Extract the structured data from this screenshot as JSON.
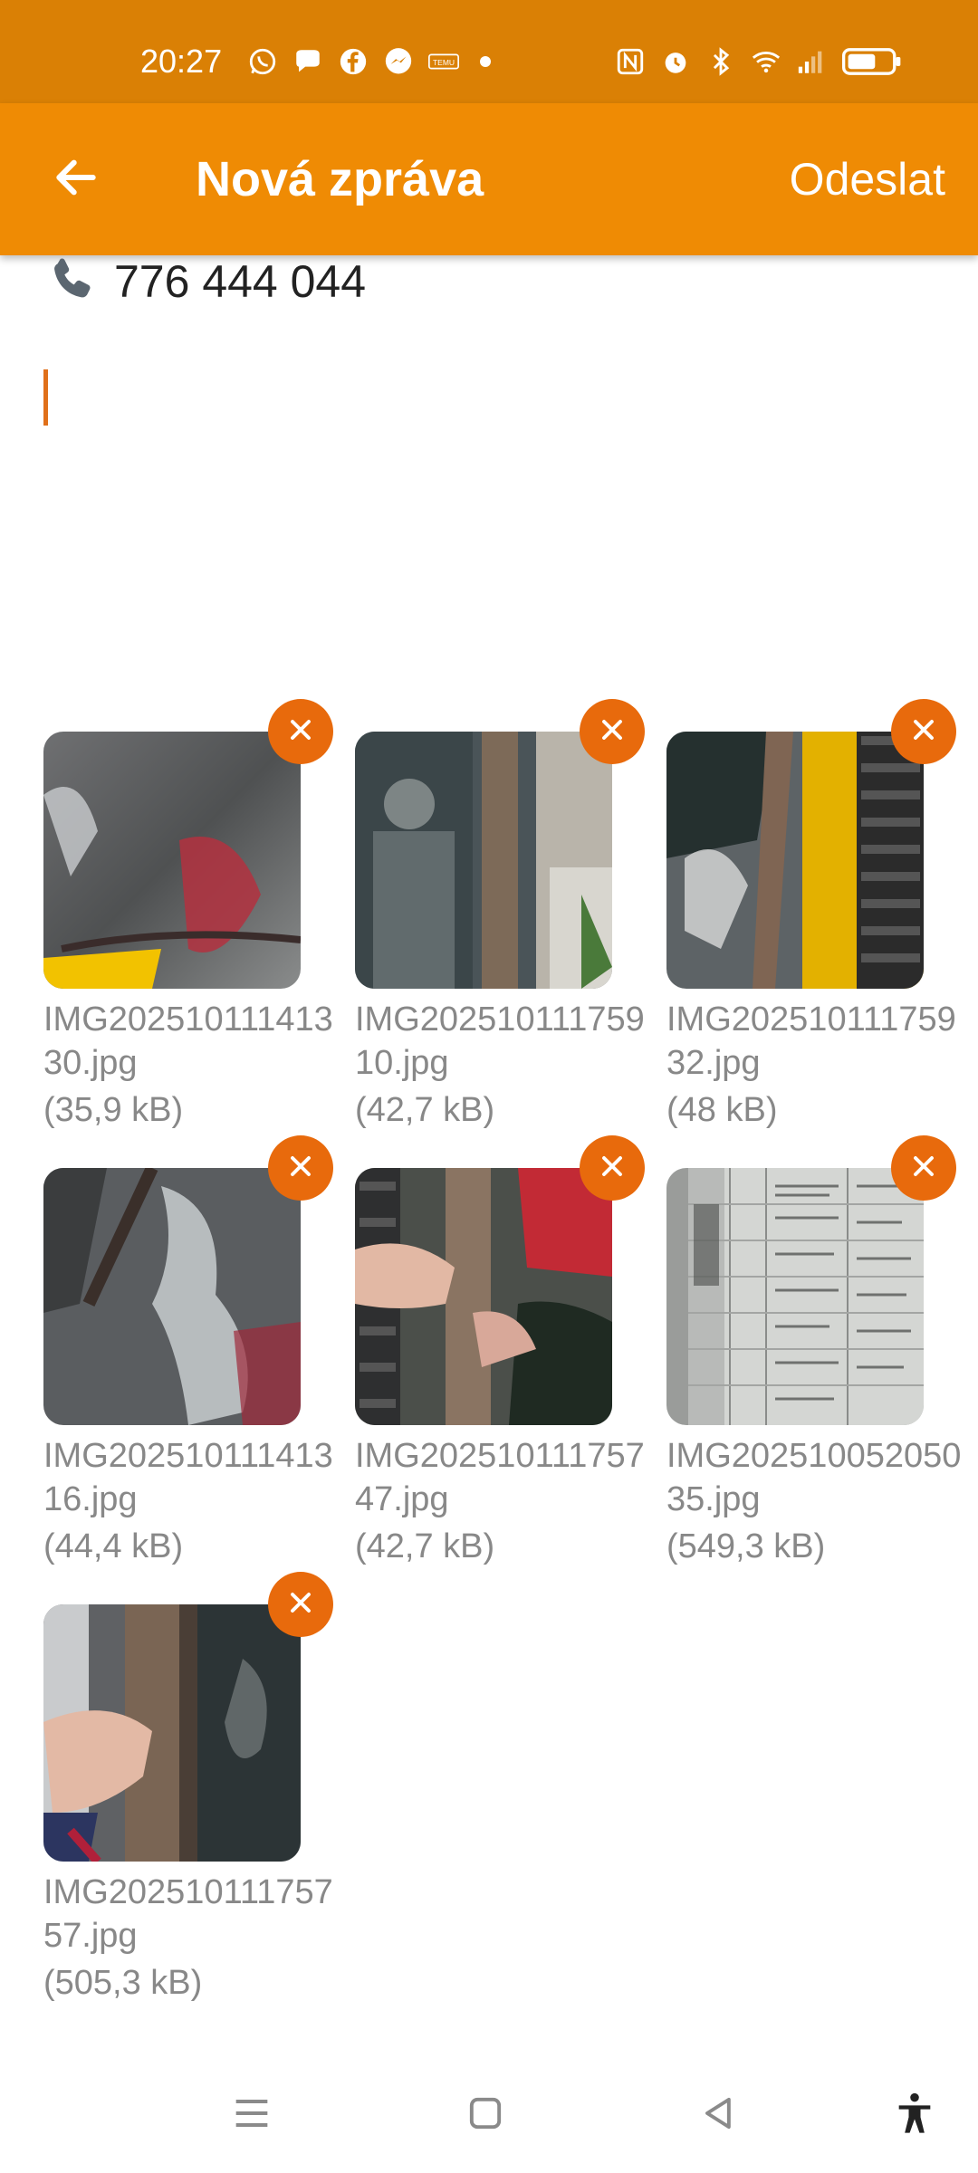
{
  "status_bar": {
    "time": "20:27",
    "left_icons": [
      "whatsapp-icon",
      "chat-bubble-icon",
      "facebook-icon",
      "messenger-icon",
      "temu-icon"
    ],
    "right_icons": [
      "nfc-icon",
      "alarm-icon",
      "bluetooth-icon",
      "wifi-icon",
      "signal-icon",
      "battery-icon"
    ]
  },
  "header": {
    "title": "Nová zpráva",
    "send_label": "Odeslat",
    "back_icon": "arrow-left-icon"
  },
  "recipient": {
    "icon": "phone-icon",
    "number": "776 444 044"
  },
  "message": {
    "value": ""
  },
  "attachments": [
    {
      "name": "IMG20251011141330.jpg",
      "size": "(35,9 kB)"
    },
    {
      "name": "IMG20251011175910.jpg",
      "size": "(42,7 kB)"
    },
    {
      "name": "IMG20251011175932.jpg",
      "size": "(48 kB)"
    },
    {
      "name": "IMG20251011141316.jpg",
      "size": "(44,4 kB)"
    },
    {
      "name": "IMG20251011175747.jpg",
      "size": "(42,7 kB)"
    },
    {
      "name": "IMG20251005205035.jpg",
      "size": "(549,3 kB)"
    },
    {
      "name": "IMG20251011175757.jpg",
      "size": "(505,3 kB)"
    }
  ],
  "nav_bar": {
    "icons": [
      "menu-icon",
      "home-icon",
      "back-icon",
      "accessibility-icon"
    ]
  },
  "colors": {
    "status_bar": "#DA8005",
    "app_bar": "#EF8B04",
    "accent": "#E86A0C",
    "cursor": "#E0701A"
  }
}
